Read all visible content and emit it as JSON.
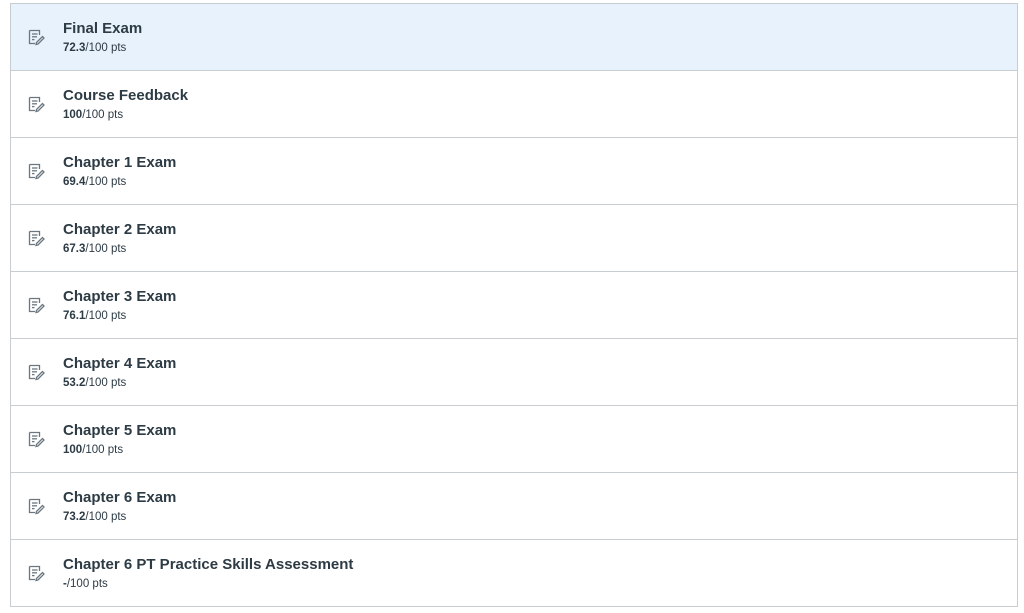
{
  "assignments": [
    {
      "title": "Final Exam",
      "earned": "72.3",
      "possible": "/100 pts",
      "icon": "quiz-icon",
      "active": true
    },
    {
      "title": "Course Feedback",
      "earned": "100",
      "possible": "/100 pts",
      "icon": "quiz-icon",
      "active": false
    },
    {
      "title": "Chapter 1 Exam",
      "earned": "69.4",
      "possible": "/100 pts",
      "icon": "quiz-icon",
      "active": false
    },
    {
      "title": "Chapter 2 Exam",
      "earned": "67.3",
      "possible": "/100 pts",
      "icon": "quiz-icon",
      "active": false
    },
    {
      "title": "Chapter 3 Exam",
      "earned": "76.1",
      "possible": "/100 pts",
      "icon": "quiz-icon",
      "active": false
    },
    {
      "title": "Chapter 4 Exam",
      "earned": "53.2",
      "possible": "/100 pts",
      "icon": "quiz-icon",
      "active": false
    },
    {
      "title": "Chapter 5 Exam",
      "earned": "100",
      "possible": "/100 pts",
      "icon": "quiz-icon",
      "active": false
    },
    {
      "title": "Chapter 6 Exam",
      "earned": "73.2",
      "possible": "/100 pts",
      "icon": "quiz-icon",
      "active": false
    },
    {
      "title": "Chapter 6 PT Practice Skills Assessment",
      "earned": "-",
      "possible": "/100 pts",
      "icon": "quiz-icon",
      "active": false
    }
  ],
  "colors": {
    "text": "#2d3b45",
    "border": "#c7cdd1",
    "active_bg": "#e8f2fc",
    "icon": "#6b7780"
  }
}
